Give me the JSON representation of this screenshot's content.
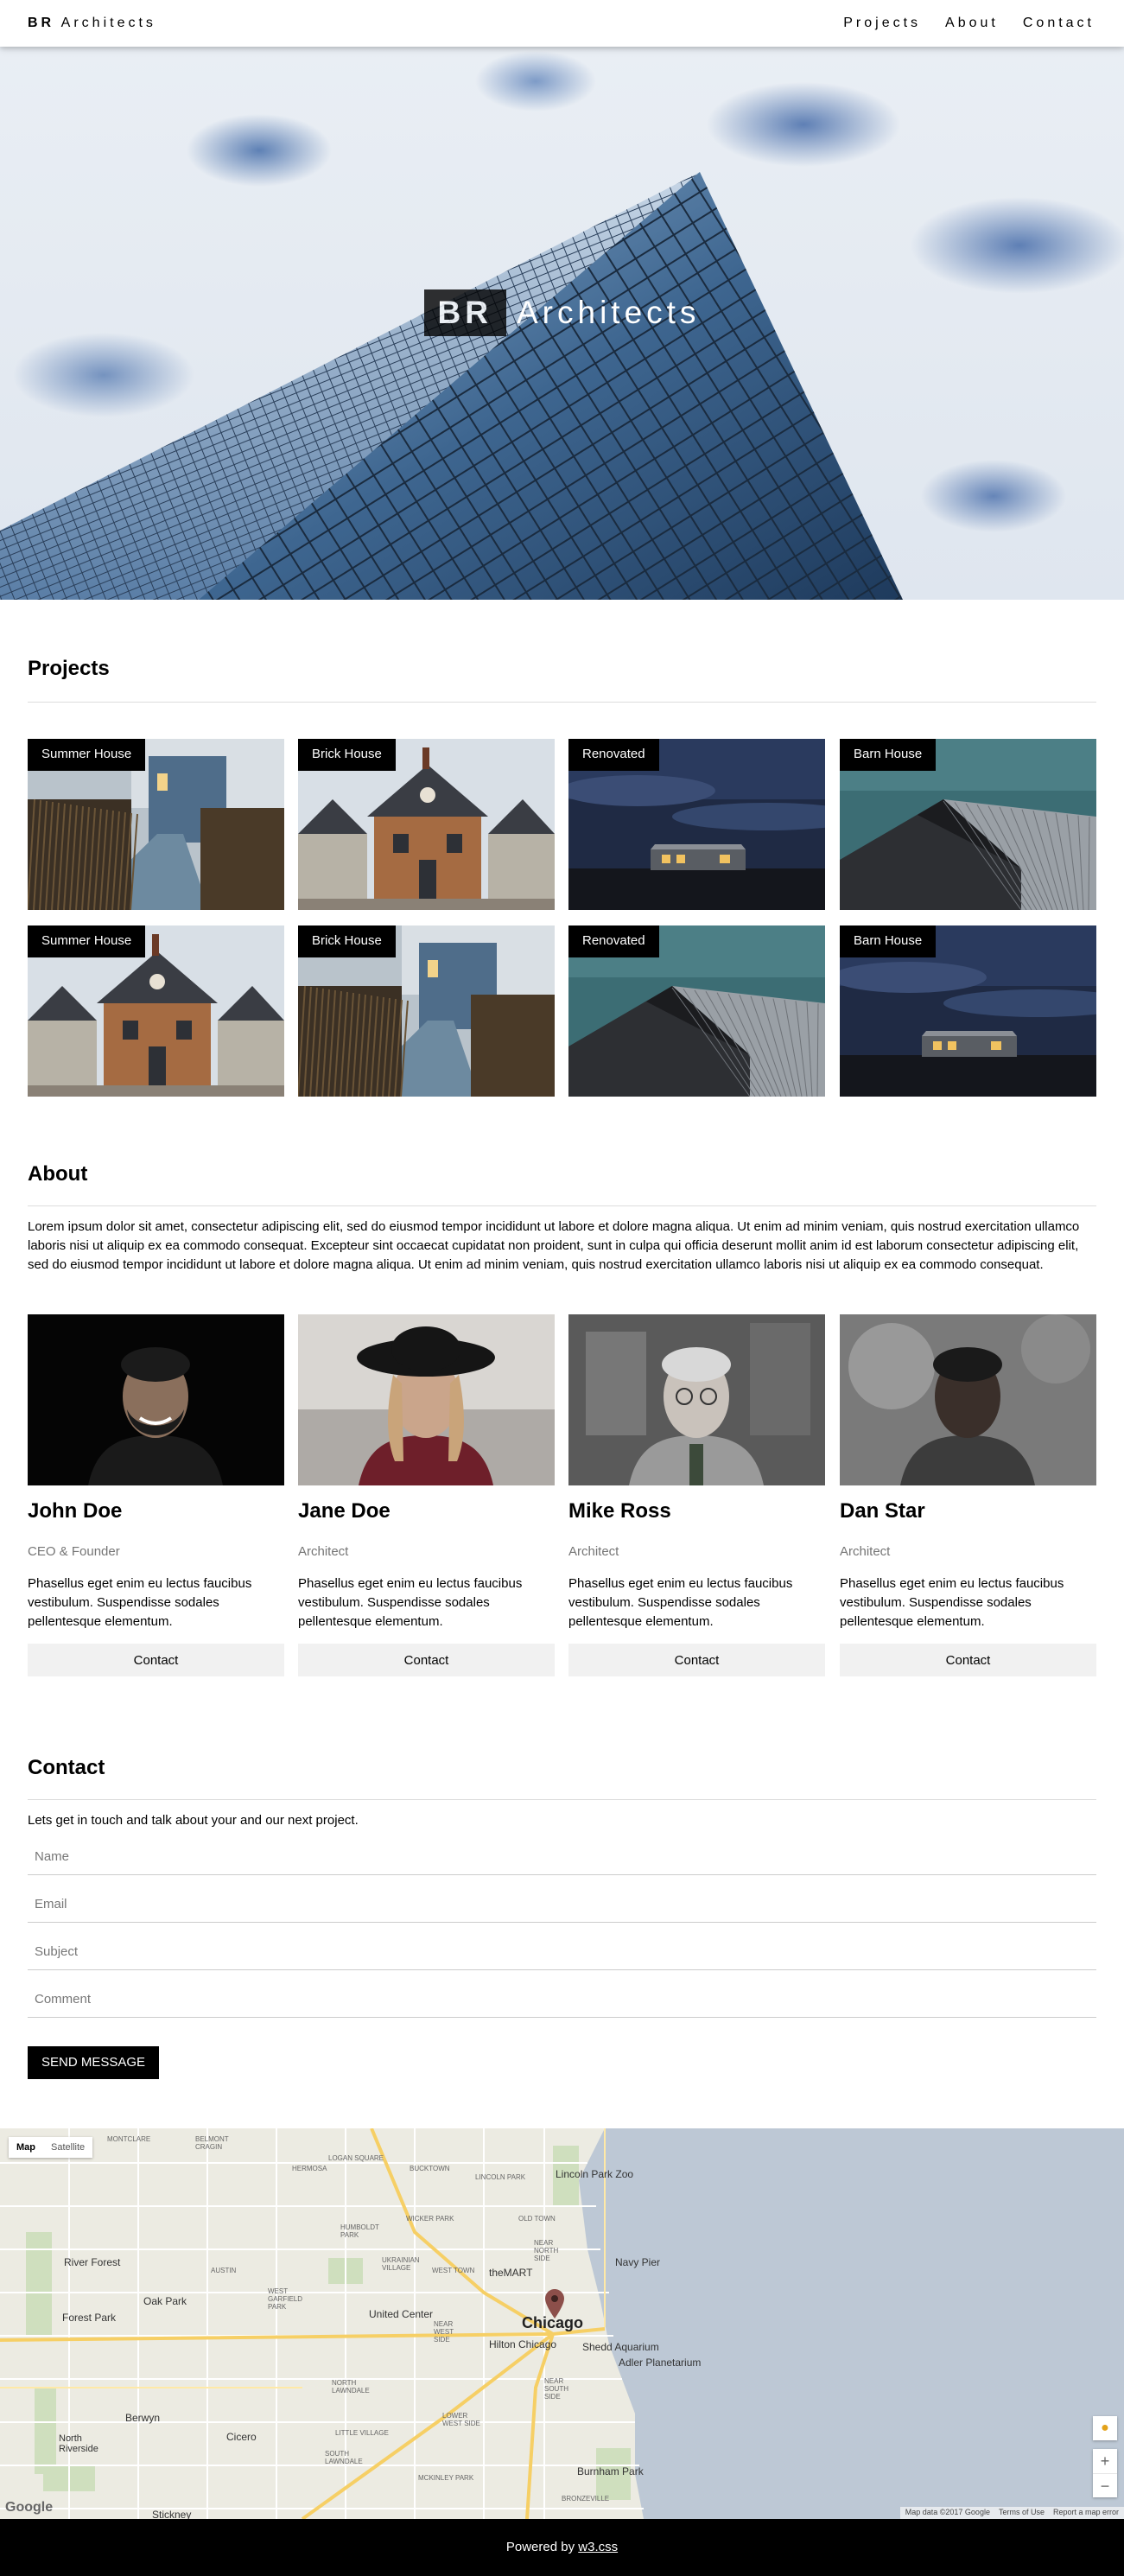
{
  "nav": {
    "brand_bold": "BR",
    "brand_rest": " Architects",
    "links": [
      "Projects",
      "About",
      "Contact"
    ]
  },
  "hero": {
    "mark": "BR",
    "word": "Architects"
  },
  "projects": {
    "heading": "Projects",
    "items": [
      {
        "label": "Summer House",
        "image": "wooden-walkway-house"
      },
      {
        "label": "Brick House",
        "image": "brick-house"
      },
      {
        "label": "Renovated",
        "image": "night-cabin"
      },
      {
        "label": "Barn House",
        "image": "barn-house"
      },
      {
        "label": "Summer House",
        "image": "brick-house"
      },
      {
        "label": "Brick House",
        "image": "wooden-walkway-house"
      },
      {
        "label": "Renovated",
        "image": "barn-house"
      },
      {
        "label": "Barn House",
        "image": "night-cabin"
      }
    ]
  },
  "about": {
    "heading": "About",
    "text": "Lorem ipsum dolor sit amet, consectetur adipiscing elit, sed do eiusmod tempor incididunt ut labore et dolore magna aliqua. Ut enim ad minim veniam, quis nostrud exercitation ullamco laboris nisi ut aliquip ex ea commodo consequat. Excepteur sint occaecat cupidatat non proident, sunt in culpa qui officia deserunt mollit anim id est laborum consectetur adipiscing elit, sed do eiusmod tempor incididunt ut labore et dolore magna aliqua. Ut enim ad minim veniam, quis nostrud exercitation ullamco laboris nisi ut aliquip ex ea commodo consequat.",
    "team": [
      {
        "name": "John Doe",
        "role": "CEO & Founder",
        "desc": "Phasellus eget enim eu lectus faucibus vestibulum. Suspendisse sodales pellentesque elementum.",
        "button": "Contact"
      },
      {
        "name": "Jane Doe",
        "role": "Architect",
        "desc": "Phasellus eget enim eu lectus faucibus vestibulum. Suspendisse sodales pellentesque elementum.",
        "button": "Contact"
      },
      {
        "name": "Mike Ross",
        "role": "Architect",
        "desc": "Phasellus eget enim eu lectus faucibus vestibulum. Suspendisse sodales pellentesque elementum.",
        "button": "Contact"
      },
      {
        "name": "Dan Star",
        "role": "Architect",
        "desc": "Phasellus eget enim eu lectus faucibus vestibulum. Suspendisse sodales pellentesque elementum.",
        "button": "Contact"
      }
    ]
  },
  "contact": {
    "heading": "Contact",
    "intro": "Lets get in touch and talk about your and our next project.",
    "placeholders": {
      "name": "Name",
      "email": "Email",
      "subject": "Subject",
      "comment": "Comment"
    },
    "send_label": "SEND MESSAGE"
  },
  "map": {
    "type_map": "Map",
    "type_satellite": "Satellite",
    "city": "Chicago",
    "labels": {
      "lincoln_park_zoo": "Lincoln Park Zoo",
      "navy_pier": "Navy Pier",
      "river_forest": "River Forest",
      "oak_park": "Oak Park",
      "forest_park": "Forest Park",
      "united_center": "United Center",
      "hilton_chicago": "Hilton Chicago",
      "shedd_aquarium": "Shedd Aquarium",
      "adler_planetarium": "Adler Planetarium",
      "berwyn": "Berwyn",
      "cicero": "Cicero",
      "north_riverside": "North Riverside",
      "burnham_park": "Burnham Park",
      "stickney": "Stickney",
      "themart": "theMART",
      "google": "Google"
    },
    "neighborhoods": [
      "MONTCLARE",
      "BELMONT CRAGIN",
      "HERMOSA",
      "LOGAN SQUARE",
      "BUCKTOWN",
      "LINCOLN PARK",
      "OLD TOWN",
      "HUMBOLDT PARK",
      "UKRAINIAN VILLAGE",
      "WEST TOWN",
      "AUSTIN",
      "WEST GARFIELD PARK",
      "NORTH LAWNDALE",
      "LITTLE VILLAGE",
      "LOWER WEST SIDE",
      "MCKINLEY PARK",
      "BRONZEVILLE",
      "NEAR NORTH SIDE",
      "NEAR WEST SIDE",
      "SOUTH LAWNDALE",
      "WICKER PARK",
      "NEAR SOUTH SIDE"
    ],
    "footer_data": "Map data ©2017 Google",
    "footer_terms": "Terms of Use",
    "footer_report": "Report a map error",
    "zoom_in": "+",
    "zoom_out": "−"
  },
  "footer": {
    "text": "Powered by ",
    "link": "w3.css"
  }
}
